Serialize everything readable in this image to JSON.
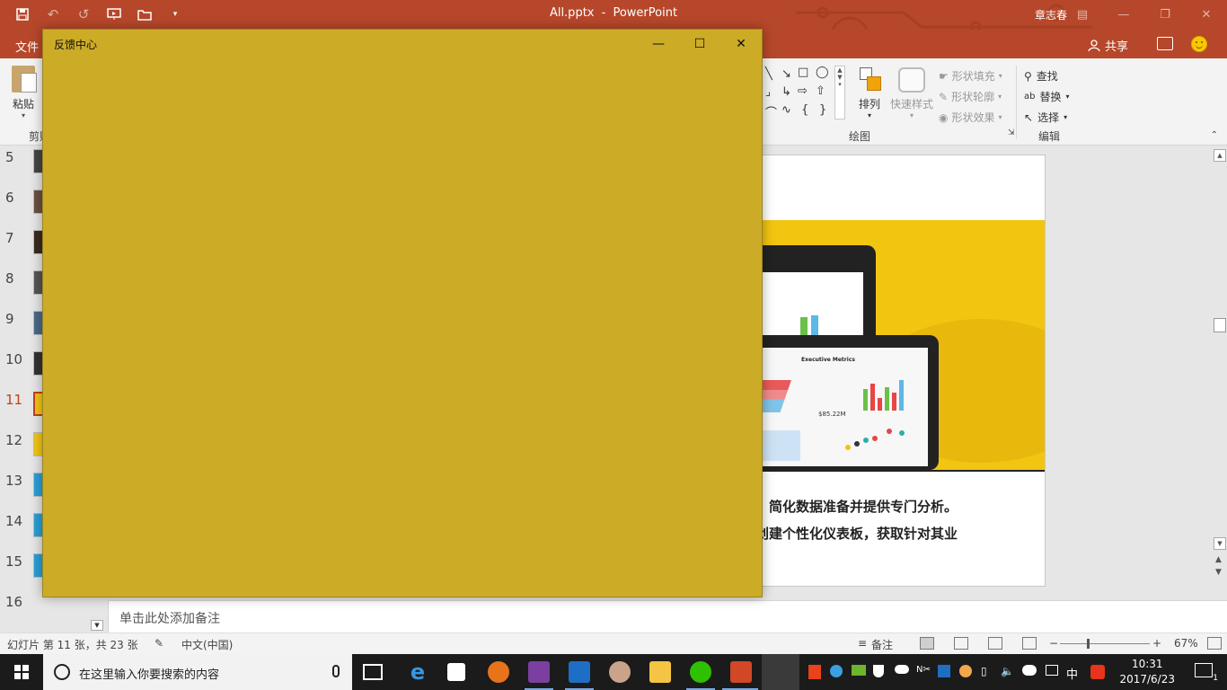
{
  "powerpoint": {
    "doc_title": "All.pptx",
    "separator": "-",
    "app_name": "PowerPoint",
    "user_name": "章志春",
    "tab_file": "文件",
    "share_label": "共享",
    "ribbon": {
      "paste_label": "粘贴",
      "clipboard_group": "剪贴",
      "drawing_group": "绘图",
      "arrange_label": "排列",
      "quick_styles_label": "快速样式",
      "shape_fill": "形状填充",
      "shape_outline": "形状轮廓",
      "shape_effects": "形状效果",
      "find_label": "查找",
      "replace_label": "替换",
      "select_label": "选择",
      "editing_group": "编辑"
    },
    "slide_numbers": [
      "5",
      "6",
      "7",
      "8",
      "9",
      "10",
      "11",
      "12",
      "13",
      "14",
      "15",
      "16"
    ],
    "active_slide": "11",
    "slide": {
      "tablet_header": "Executive Metrics",
      "kpi_value": "$85.22M",
      "line1": "据源、简化数据准备并提供专门分析。",
      "line2": "都可创建个性化仪表板，获取针对其业"
    },
    "notes_placeholder": "单击此处添加备注",
    "status": {
      "slide_count": "幻灯片 第 11 张，共 23 张",
      "language": "中文(中国)",
      "notes_label": "备注",
      "zoom": "67%"
    }
  },
  "feedback_hub": {
    "title": "反馈中心",
    "bg_color": "#ccab27"
  },
  "taskbar": {
    "search_placeholder": "在这里输入你要搜索的内容",
    "ime_label": "中",
    "time": "10:31",
    "date": "2017/6/23",
    "notification_count": "1"
  }
}
